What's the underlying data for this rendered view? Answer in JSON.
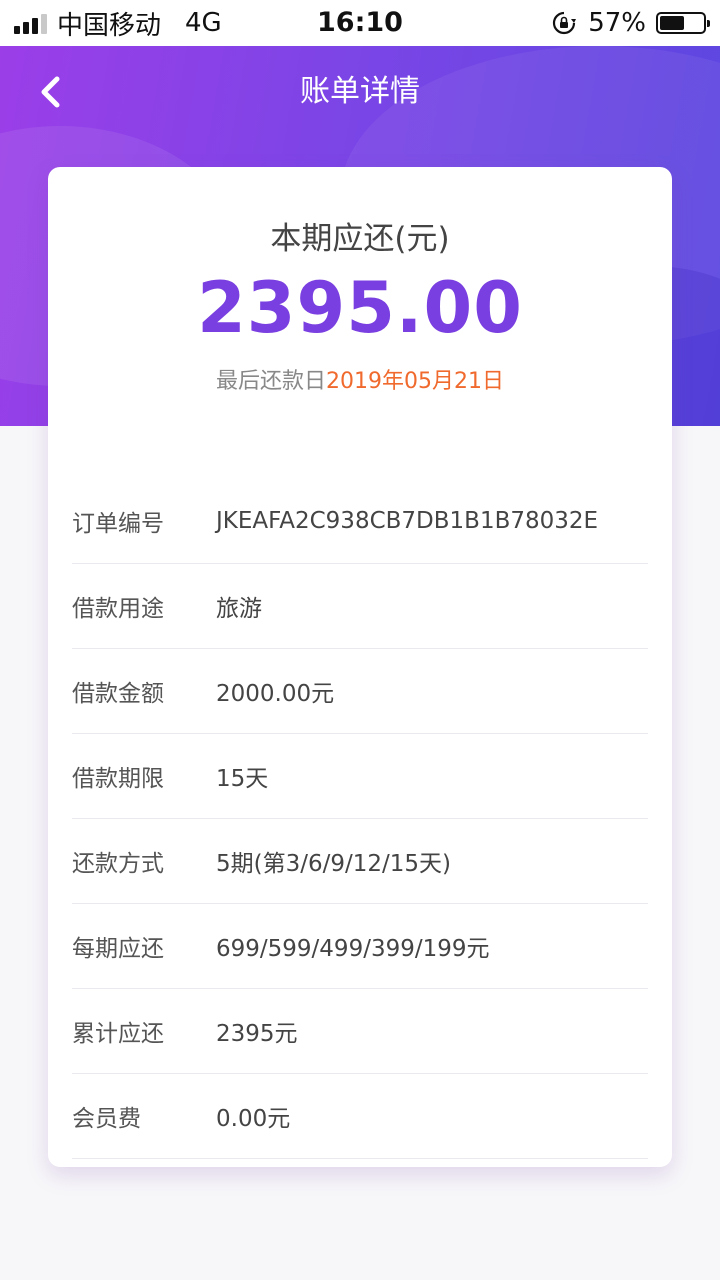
{
  "status_bar": {
    "carrier": "中国移动",
    "network": "4G",
    "time": "16:10",
    "battery_text": "57%",
    "battery_level": 0.57
  },
  "nav": {
    "title": "账单详情",
    "back_icon": "chevron-left-icon"
  },
  "summary": {
    "label": "本期应还(元)",
    "amount": "2395.00",
    "deadline_label": "最后还款日",
    "deadline_value": "2019年05月21日"
  },
  "details": [
    {
      "key": "订单编号",
      "value": "JKEAFA2C938CB7DB1B1B78032E"
    },
    {
      "key": "借款用途",
      "value": "旅游"
    },
    {
      "key": "借款金额",
      "value": "2000.00元"
    },
    {
      "key": "借款期限",
      "value": "15天"
    },
    {
      "key": "还款方式",
      "value": "5期(第3/6/9/12/15天)"
    },
    {
      "key": "每期应还",
      "value": "699/599/499/399/199元"
    },
    {
      "key": "累计应还",
      "value": "2395元"
    },
    {
      "key": "会员费",
      "value": "0.00元"
    }
  ],
  "colors": {
    "accent": "#7a3fe0",
    "date_highlight": "#f06a2e",
    "header_start": "#9b3ee8",
    "header_end": "#5a47e0"
  }
}
